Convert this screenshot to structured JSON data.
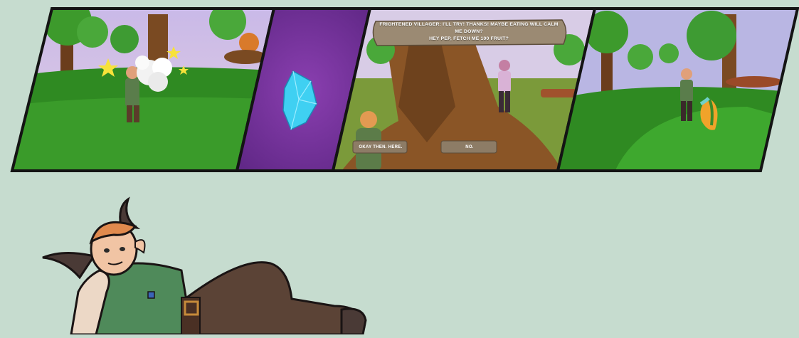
{
  "colors": {
    "background": "#c6dccf",
    "panel_border": "#141414",
    "sky": "#b9b6e3",
    "grass": "#2f8a22",
    "crystal_bg": "#6d2f95",
    "crystal": "#3fd0f2",
    "bark": "#7a4a22",
    "scroll": "#9b8a73"
  },
  "panels": [
    {
      "name": "sparkle-bush-scene",
      "icons": [
        "star-icon",
        "smoke-puff-icon"
      ]
    },
    {
      "name": "crystal-closeup",
      "icons": [
        "crystal-icon"
      ]
    },
    {
      "name": "villager-dialogue-scene",
      "dialogue": {
        "line1": "FRIGHTENED VILLAGER: I'LL TRY! THANKS! MAYBE EATING WILL CALM ME DOWN?",
        "line2": "HEY PEP, FETCH ME 100 FRUIT?"
      },
      "choices": [
        "OKAY THEN. HERE.",
        "NO."
      ]
    },
    {
      "name": "forest-meadow-scene",
      "icons": [
        "fruit-icon"
      ]
    }
  ],
  "mascot": {
    "name": "pep-character",
    "pose": "lying down"
  }
}
